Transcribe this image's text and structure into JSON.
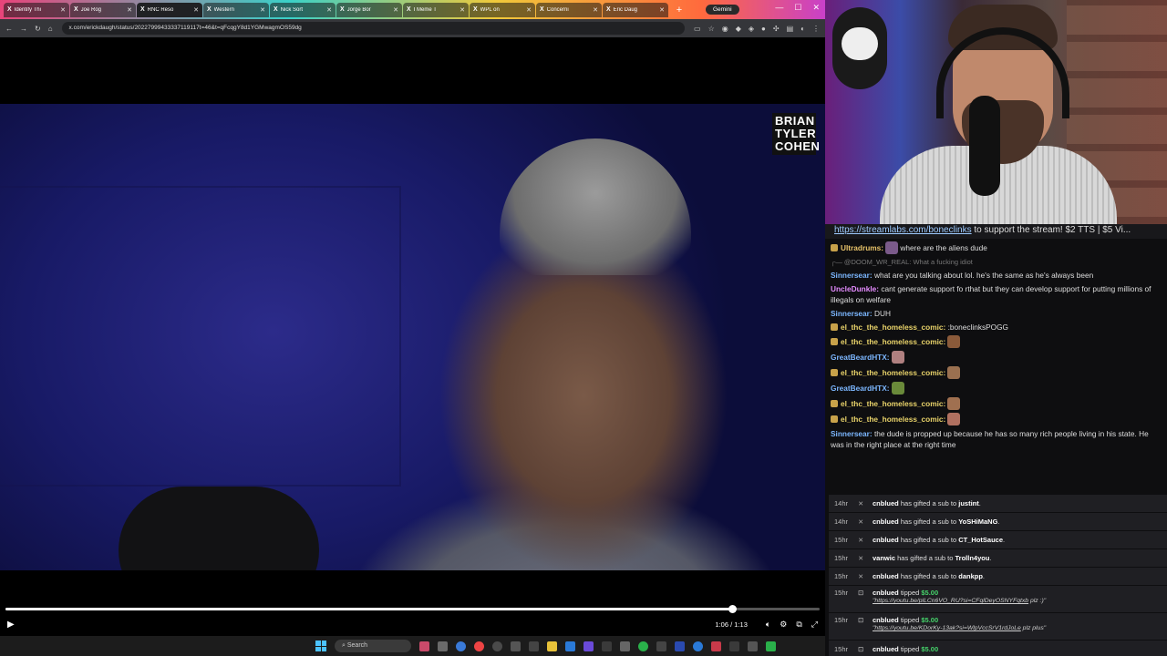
{
  "browser": {
    "tabs": [
      {
        "label": "Identify Thi"
      },
      {
        "label": "Joe Rog"
      },
      {
        "label": "RNC Reso"
      },
      {
        "label": "Western"
      },
      {
        "label": "Nick Sort"
      },
      {
        "label": "Jorge Bor"
      },
      {
        "label": "I Meme T"
      },
      {
        "label": "WPL on"
      },
      {
        "label": "Concerni"
      },
      {
        "label": "Eric Daug"
      }
    ],
    "gemini_label": "Gemini",
    "url": "x.com/erickdaugh/status/20227999433337119117t=46&t=qFcqgY8d1YGMwagmOS59dg"
  },
  "video": {
    "watermark": [
      "BRIAN",
      "TYLER",
      "COHEN"
    ],
    "time": "1:06 / 1:13",
    "progress": 0.893
  },
  "taskbar": {
    "search_label": "Search"
  },
  "chat": {
    "pinned_link": "https://streamlabs.com/boneclinks",
    "pinned_text": " to support the stream! $2 TTS | $5 Vi...",
    "messages": [
      {
        "user": "Ultradrums",
        "color": "#e9c46a",
        "text": " where are the aliens dude",
        "badge": true,
        "emote": "#7a5a8a"
      },
      {
        "reply": "@DOOM_WR_REAL: What a fucking idiot"
      },
      {
        "user": "Sinnersear",
        "color": "#7cb7ff",
        "text": " what are you talking about lol. he's the same as he's always been"
      },
      {
        "user": "UncleDunkle",
        "color": "#e58cff",
        "text": " cant generate support fo rthat but they can develop support for putting millions of illegals on welfare"
      },
      {
        "user": "Sinnersear",
        "color": "#7cb7ff",
        "text": " DUH"
      },
      {
        "user": "el_thc_the_homeless_comic",
        "color": "#e9d36a",
        "text": " :boneclinksPOGG",
        "badge": true
      },
      {
        "user": "el_thc_the_homeless_comic",
        "color": "#e9d36a",
        "text": "",
        "badge": true,
        "emote": "#8a5a3a"
      },
      {
        "user": "GreatBeardHTX",
        "color": "#7cb7ff",
        "text": "",
        "emote": "#b08080"
      },
      {
        "user": "el_thc_the_homeless_comic",
        "color": "#e9d36a",
        "text": "",
        "badge": true,
        "emote": "#9a7050"
      },
      {
        "user": "GreatBeardHTX",
        "color": "#7cb7ff",
        "text": "",
        "emote": "#6a8a3a"
      },
      {
        "user": "el_thc_the_homeless_comic",
        "color": "#e9d36a",
        "text": "",
        "badge": true,
        "emote": "#a07050"
      },
      {
        "user": "el_thc_the_homeless_comic",
        "color": "#e9d36a",
        "text": "",
        "badge": true,
        "emote": "#b07060"
      },
      {
        "user": "Sinnersear",
        "color": "#7cb7ff",
        "text": " the dude is propped up because he has so many rich people living in his state. He was in the right place at the right time"
      }
    ],
    "events": [
      {
        "age": "14hr",
        "user": "cnblued",
        "action": " has gifted a sub to ",
        "target": "justint",
        "end": "."
      },
      {
        "age": "14hr",
        "user": "cnblued",
        "action": " has gifted a sub to ",
        "target": "YoSHiMaNG",
        "end": "."
      },
      {
        "age": "15hr",
        "user": "cnblued",
        "action": " has gifted a sub to ",
        "target": "CT_HotSauce",
        "end": "."
      },
      {
        "age": "15hr",
        "user": "vanwic",
        "action": " has gifted a sub to ",
        "target": "Trolln4you",
        "end": "."
      },
      {
        "age": "15hr",
        "user": "cnblued",
        "action": " has gifted a sub to ",
        "target": "dankpp",
        "end": "."
      },
      {
        "age": "15hr",
        "user": "cnblued",
        "action": " tipped ",
        "amount": "$5.00",
        "note_link": "https://youtu.be/plLCn6VO_RU?si=CFqlDeyOSNYFqtxb",
        "note_tail": " plz :)\""
      },
      {
        "age": "15hr",
        "user": "cnblued",
        "action": " tipped ",
        "amount": "$5.00",
        "note_link": "https://youtu.be/KDorKy-13ak?si=WlpVccSrV1rdJoLe",
        "note_tail": " plz plus\""
      },
      {
        "age": "15hr",
        "user": "cnblued",
        "action": " tipped ",
        "amount": "$5.00"
      }
    ]
  }
}
